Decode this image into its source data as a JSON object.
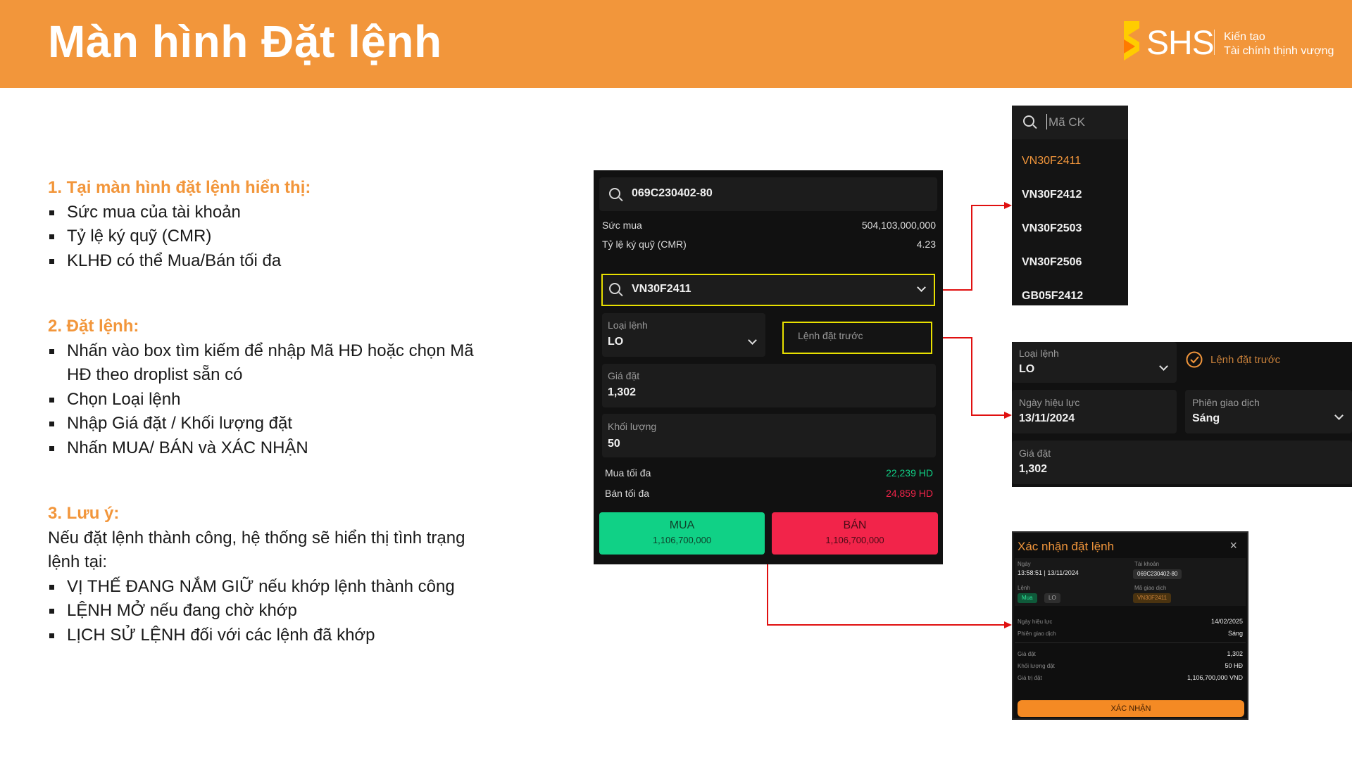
{
  "header": {
    "title": "Màn hình Đặt lệnh",
    "brand": "SHS",
    "tagline_line1": "Kiến tạo",
    "tagline_line2": "Tài chính thịnh vượng",
    "bg_color": "#f2963b"
  },
  "instructions": {
    "s1_title": "1. Tại màn hình đặt lệnh hiển thị:",
    "s1_items": [
      "Sức mua của tài khoản",
      "Tỷ lệ ký quỹ (CMR)",
      "KLHĐ có thể Mua/Bán tối đa"
    ],
    "s2_title": "2. Đặt lệnh:",
    "s2_items": [
      "Nhấn vào box tìm kiếm để nhập Mã HĐ hoặc chọn Mã HĐ theo droplist sẵn có",
      "Chọn Loại lệnh",
      "Nhập Giá đặt / Khối lượng đặt",
      "Nhấn MUA/ BÁN và XÁC NHẬN"
    ],
    "s3_title": "3. Lưu ý:",
    "s3_intro": "Nếu đặt lệnh thành công, hệ thống sẽ hiển thị tình trạng lệnh tại:",
    "s3_items": [
      "VỊ THẾ ĐANG NẮM GIỮ nếu khớp lệnh thành công",
      "LỆNH MỞ nếu đang chờ khớp",
      "LỊCH SỬ LỆNH đối với các lệnh đã khớp"
    ]
  },
  "order_panel": {
    "account": "069C230402-80",
    "buying_power_label": "Sức mua",
    "buying_power_value": "504,103,000,000",
    "cmr_label": "Tỷ lệ ký quỹ (CMR)",
    "cmr_value": "4.23",
    "contract": "VN30F2411",
    "order_type_label": "Loại lệnh",
    "order_type_value": "LO",
    "pre_order_placeholder": "Lệnh đặt trước",
    "price_label": "Giá đặt",
    "price_value": "1,302",
    "qty_label": "Khối lượng",
    "qty_value": "50",
    "max_buy_label": "Mua tối đa",
    "max_buy_value": "22,239 HD",
    "max_sell_label": "Bán tối đa",
    "max_sell_value": "24,859 HD",
    "buy_label": "MUA",
    "buy_amount": "1,106,700,000",
    "sell_label": "BÁN",
    "sell_amount": "1,106,700,000",
    "buy_color": "#10d186",
    "sell_color": "#f2244a"
  },
  "dropdown": {
    "placeholder": "Mã CK",
    "items": [
      "VN30F2411",
      "VN30F2412",
      "VN30F2503",
      "VN30F2506",
      "GB05F2412"
    ],
    "selected_color": "#f2963b"
  },
  "pre_order_panel": {
    "order_type_label": "Loại lệnh",
    "order_type_value": "LO",
    "pre_order_label": "Lệnh đặt trước",
    "effective_date_label": "Ngày hiệu lực",
    "effective_date_value": "13/11/2024",
    "session_label": "Phiên giao dịch",
    "session_value": "Sáng",
    "price_label": "Giá đặt",
    "price_value": "1,302"
  },
  "confirm": {
    "title": "Xác nhận đặt lệnh",
    "close": "×",
    "date_label": "Ngày",
    "date_value": "13:58:51 | 13/11/2024",
    "account_label": "Tài khoản",
    "account_value": "069C230402-80",
    "order_label": "Lệnh",
    "side_value": "Mua",
    "type_value": "LO",
    "symbol_label": "Mã giao dịch",
    "symbol_value": "VN30F2411",
    "eff_label": "Ngày hiệu lực",
    "eff_value": "14/02/2025",
    "session_label": "Phiên giao dịch",
    "session_value": "Sáng",
    "price_label": "Giá đặt",
    "price_value": "1,302",
    "qty_label": "Khối lượng đặt",
    "qty_value": "50 HĐ",
    "total_label": "Giá trị đặt",
    "total_value": "1,106,700,000 VND",
    "confirm_button": "XÁC NHẬN"
  }
}
